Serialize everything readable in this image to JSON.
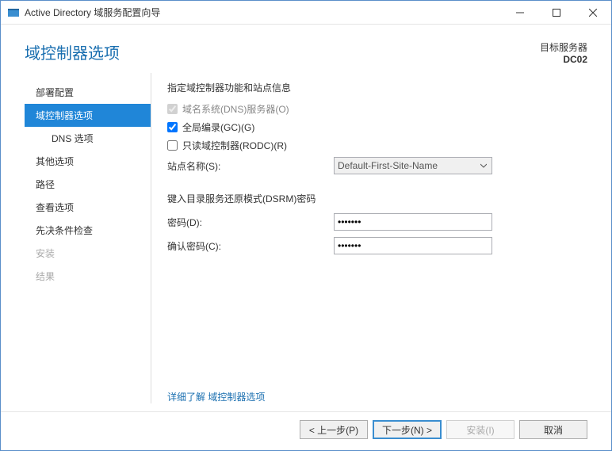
{
  "window": {
    "title": "Active Directory 域服务配置向导"
  },
  "header": {
    "page_title": "域控制器选项",
    "target_label": "目标服务器",
    "target_value": "DC02"
  },
  "sidebar": {
    "items": [
      {
        "label": "部署配置"
      },
      {
        "label": "域控制器选项"
      },
      {
        "label": "DNS 选项"
      },
      {
        "label": "其他选项"
      },
      {
        "label": "路径"
      },
      {
        "label": "查看选项"
      },
      {
        "label": "先决条件检查"
      },
      {
        "label": "安装"
      },
      {
        "label": "结果"
      }
    ]
  },
  "main": {
    "section1_label": "指定域控制器功能和站点信息",
    "chk_dns": "域名系统(DNS)服务器(O)",
    "chk_gc": "全局编录(GC)(G)",
    "chk_rodc": "只读域控制器(RODC)(R)",
    "site_label": "站点名称(S):",
    "site_value": "Default-First-Site-Name",
    "section2_label": "键入目录服务还原模式(DSRM)密码",
    "pwd_label": "密码(D):",
    "pwd_value": "•••••••",
    "pwd2_label": "确认密码(C):",
    "pwd2_value": "•••••••",
    "more_prefix": "详细了解 ",
    "more_link": "域控制器选项"
  },
  "footer": {
    "prev": "< 上一步(P)",
    "next": "下一步(N) >",
    "install": "安装(I)",
    "cancel": "取消"
  }
}
